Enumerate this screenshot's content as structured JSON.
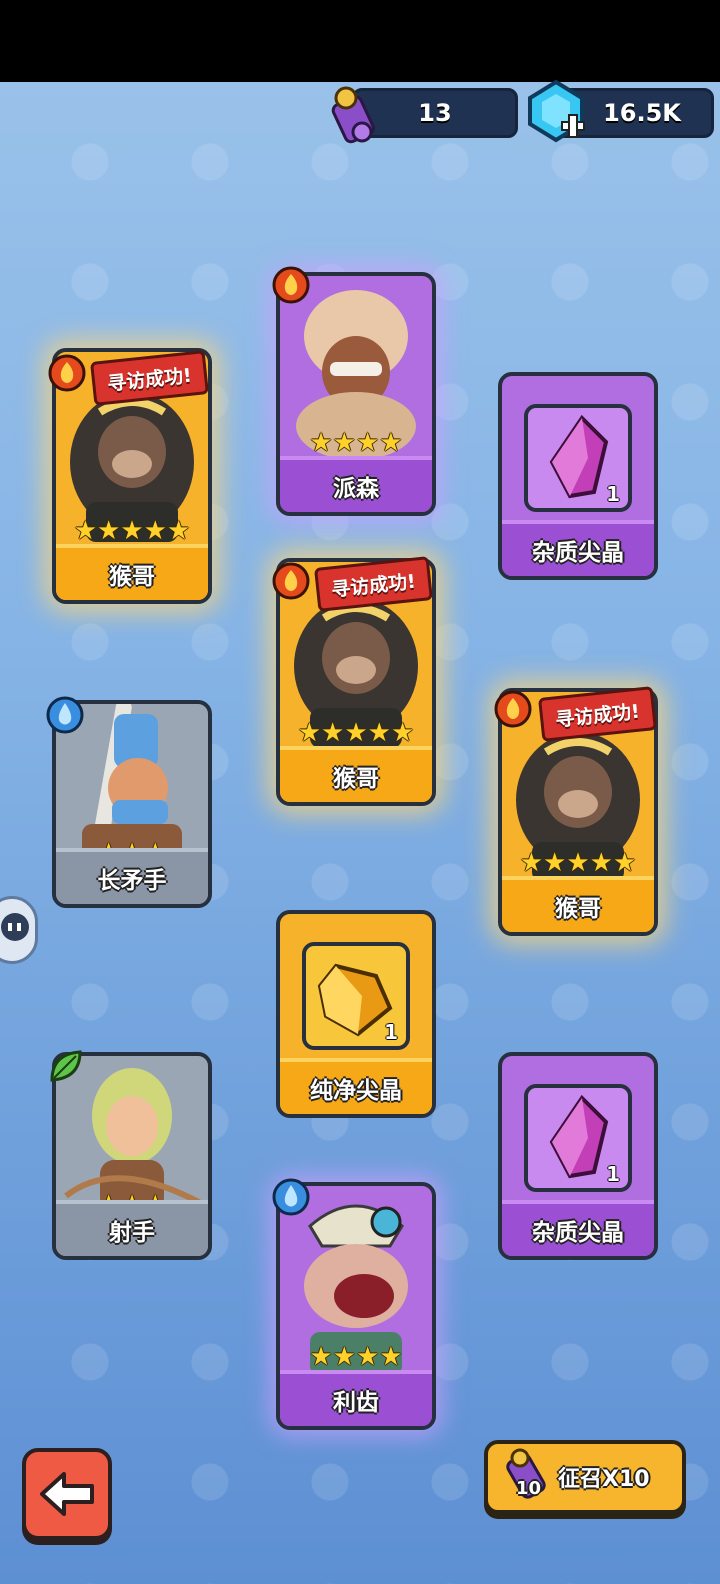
{
  "currency": {
    "scrolls": "13",
    "gems": "16.5K"
  },
  "banner_text": "寻访成功!",
  "cards": [
    {
      "name": "猴哥",
      "stars": "★★★★★",
      "rarity": "gold",
      "element": "fire"
    },
    {
      "name": "派森",
      "stars": "★★★★",
      "rarity": "purple",
      "element": "fire"
    },
    {
      "name": "杂质尖晶",
      "count": "1",
      "rarity": "purple",
      "type": "item"
    },
    {
      "name": "猴哥",
      "stars": "★★★★★",
      "rarity": "gold",
      "element": "fire"
    },
    {
      "name": "长矛手",
      "stars": "★★★",
      "rarity": "grey",
      "element": "water"
    },
    {
      "name": "猴哥",
      "stars": "★★★★★",
      "rarity": "gold",
      "element": "fire"
    },
    {
      "name": "纯净尖晶",
      "count": "1",
      "rarity": "gold",
      "type": "item"
    },
    {
      "name": "射手",
      "stars": "★★★",
      "rarity": "grey",
      "element": "leaf"
    },
    {
      "name": "杂质尖晶",
      "count": "1",
      "rarity": "purple",
      "type": "item"
    },
    {
      "name": "利齿",
      "stars": "★★★★",
      "rarity": "purple",
      "element": "water"
    }
  ],
  "recruit_button": {
    "label": "征召X10",
    "count": "10"
  },
  "colors": {
    "gold": "#f6b22a",
    "purple": "#b06ee0",
    "grey": "#9ba6b5",
    "back": "#ef5a45"
  }
}
